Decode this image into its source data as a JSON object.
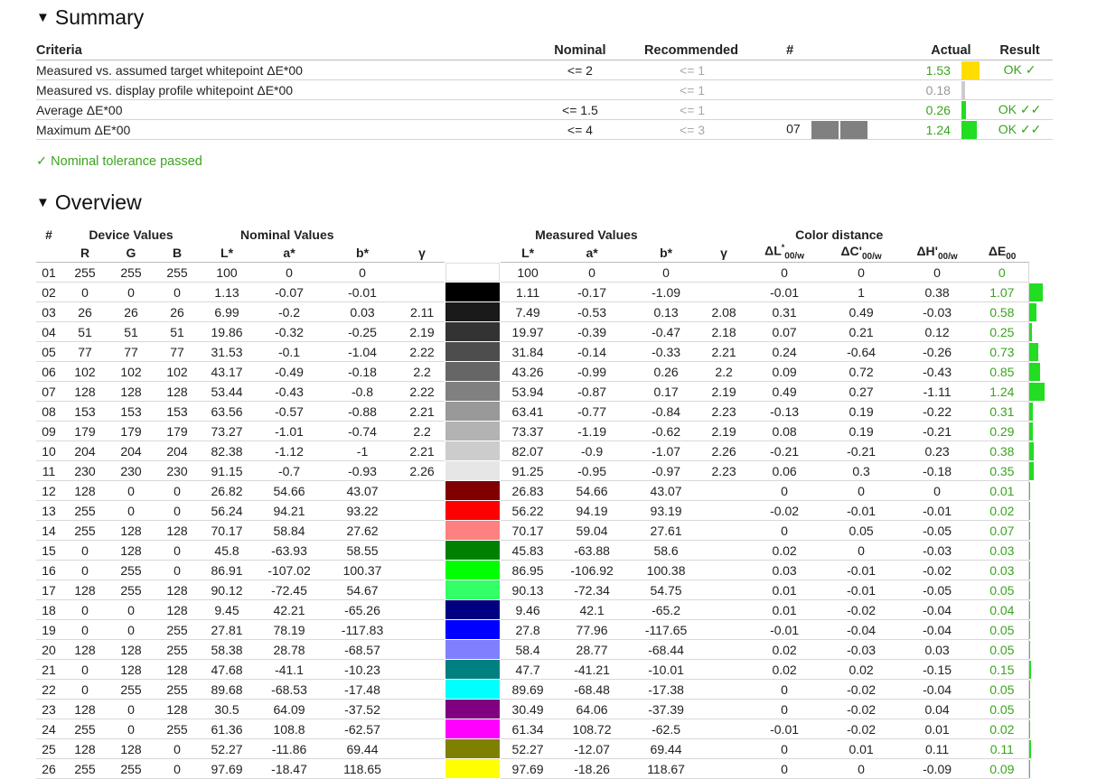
{
  "summary": {
    "title": "Summary",
    "headers": {
      "criteria": "Criteria",
      "nominal": "Nominal",
      "recommended": "Recommended",
      "hash": "#",
      "actual": "Actual",
      "result": "Result"
    },
    "rows": [
      {
        "criteria": "Measured vs. assumed target whitepoint ΔE*00",
        "nominal": "<= 2",
        "recommended": "<= 1",
        "hash": "",
        "actual": "1.53",
        "result": "OK ✓",
        "color": "#ffdd00",
        "swatch_width": 20
      },
      {
        "criteria": "Measured vs. display profile whitepoint ΔE*00",
        "nominal": "",
        "recommended": "<= 1",
        "hash": "",
        "actual": "0.18",
        "result": "",
        "color": "#cccccc",
        "swatch_width": 4
      },
      {
        "criteria": "Average ΔE*00",
        "nominal": "<= 1.5",
        "recommended": "<= 1",
        "hash": "",
        "actual": "0.26",
        "result": "OK ✓✓",
        "color": "#22dd22",
        "swatch_width": 5
      },
      {
        "criteria": "Maximum ΔE*00",
        "nominal": "<= 4",
        "recommended": "<= 3",
        "hash": "07",
        "actual": "1.24",
        "result": "OK ✓✓",
        "color": "#22dd22",
        "swatch_width": 17
      }
    ],
    "tolerance_text": "✓ Nominal tolerance passed",
    "patch_color": "#808080"
  },
  "overview": {
    "title": "Overview",
    "group_headers": {
      "hash": "#",
      "device": "Device Values",
      "nominal": "Nominal Values",
      "measured": "Measured Values",
      "distance": "Color distance"
    },
    "col_headers": {
      "r": "R",
      "g": "G",
      "b": "B",
      "l": "L*",
      "a": "a*",
      "bb": "b*",
      "gamma": "γ"
    },
    "rows": [
      {
        "n": "01",
        "r": "255",
        "g": "255",
        "b": "255",
        "nl": "100",
        "na": "0",
        "nb": "0",
        "ng": "",
        "color": "#ffffff",
        "ml": "100",
        "ma": "0",
        "mb": "0",
        "mg": "",
        "dl": "0",
        "dc": "0",
        "dh": "0",
        "de": "0"
      },
      {
        "n": "02",
        "r": "0",
        "g": "0",
        "b": "0",
        "nl": "1.13",
        "na": "-0.07",
        "nb": "-0.01",
        "ng": "",
        "color": "#000000",
        "ml": "1.11",
        "ma": "-0.17",
        "mb": "-1.09",
        "mg": "",
        "dl": "-0.01",
        "dc": "1",
        "dh": "0.38",
        "de": "1.07"
      },
      {
        "n": "03",
        "r": "26",
        "g": "26",
        "b": "26",
        "nl": "6.99",
        "na": "-0.2",
        "nb": "0.03",
        "ng": "2.11",
        "color": "#1a1a1a",
        "ml": "7.49",
        "ma": "-0.53",
        "mb": "0.13",
        "mg": "2.08",
        "dl": "0.31",
        "dc": "0.49",
        "dh": "-0.03",
        "de": "0.58"
      },
      {
        "n": "04",
        "r": "51",
        "g": "51",
        "b": "51",
        "nl": "19.86",
        "na": "-0.32",
        "nb": "-0.25",
        "ng": "2.19",
        "color": "#333333",
        "ml": "19.97",
        "ma": "-0.39",
        "mb": "-0.47",
        "mg": "2.18",
        "dl": "0.07",
        "dc": "0.21",
        "dh": "0.12",
        "de": "0.25"
      },
      {
        "n": "05",
        "r": "77",
        "g": "77",
        "b": "77",
        "nl": "31.53",
        "na": "-0.1",
        "nb": "-1.04",
        "ng": "2.22",
        "color": "#4d4d4d",
        "ml": "31.84",
        "ma": "-0.14",
        "mb": "-0.33",
        "mg": "2.21",
        "dl": "0.24",
        "dc": "-0.64",
        "dh": "-0.26",
        "de": "0.73"
      },
      {
        "n": "06",
        "r": "102",
        "g": "102",
        "b": "102",
        "nl": "43.17",
        "na": "-0.49",
        "nb": "-0.18",
        "ng": "2.2",
        "color": "#666666",
        "ml": "43.26",
        "ma": "-0.99",
        "mb": "0.26",
        "mg": "2.2",
        "dl": "0.09",
        "dc": "0.72",
        "dh": "-0.43",
        "de": "0.85"
      },
      {
        "n": "07",
        "r": "128",
        "g": "128",
        "b": "128",
        "nl": "53.44",
        "na": "-0.43",
        "nb": "-0.8",
        "ng": "2.22",
        "color": "#808080",
        "ml": "53.94",
        "ma": "-0.87",
        "mb": "0.17",
        "mg": "2.19",
        "dl": "0.49",
        "dc": "0.27",
        "dh": "-1.11",
        "de": "1.24"
      },
      {
        "n": "08",
        "r": "153",
        "g": "153",
        "b": "153",
        "nl": "63.56",
        "na": "-0.57",
        "nb": "-0.88",
        "ng": "2.21",
        "color": "#999999",
        "ml": "63.41",
        "ma": "-0.77",
        "mb": "-0.84",
        "mg": "2.23",
        "dl": "-0.13",
        "dc": "0.19",
        "dh": "-0.22",
        "de": "0.31"
      },
      {
        "n": "09",
        "r": "179",
        "g": "179",
        "b": "179",
        "nl": "73.27",
        "na": "-1.01",
        "nb": "-0.74",
        "ng": "2.2",
        "color": "#b3b3b3",
        "ml": "73.37",
        "ma": "-1.19",
        "mb": "-0.62",
        "mg": "2.19",
        "dl": "0.08",
        "dc": "0.19",
        "dh": "-0.21",
        "de": "0.29"
      },
      {
        "n": "10",
        "r": "204",
        "g": "204",
        "b": "204",
        "nl": "82.38",
        "na": "-1.12",
        "nb": "-1",
        "ng": "2.21",
        "color": "#cccccc",
        "ml": "82.07",
        "ma": "-0.9",
        "mb": "-1.07",
        "mg": "2.26",
        "dl": "-0.21",
        "dc": "-0.21",
        "dh": "0.23",
        "de": "0.38"
      },
      {
        "n": "11",
        "r": "230",
        "g": "230",
        "b": "230",
        "nl": "91.15",
        "na": "-0.7",
        "nb": "-0.93",
        "ng": "2.26",
        "color": "#e6e6e6",
        "ml": "91.25",
        "ma": "-0.95",
        "mb": "-0.97",
        "mg": "2.23",
        "dl": "0.06",
        "dc": "0.3",
        "dh": "-0.18",
        "de": "0.35"
      },
      {
        "n": "12",
        "r": "128",
        "g": "0",
        "b": "0",
        "nl": "26.82",
        "na": "54.66",
        "nb": "43.07",
        "ng": "",
        "color": "#800000",
        "ml": "26.83",
        "ma": "54.66",
        "mb": "43.07",
        "mg": "",
        "dl": "0",
        "dc": "0",
        "dh": "0",
        "de": "0.01"
      },
      {
        "n": "13",
        "r": "255",
        "g": "0",
        "b": "0",
        "nl": "56.24",
        "na": "94.21",
        "nb": "93.22",
        "ng": "",
        "color": "#ff0000",
        "ml": "56.22",
        "ma": "94.19",
        "mb": "93.19",
        "mg": "",
        "dl": "-0.02",
        "dc": "-0.01",
        "dh": "-0.01",
        "de": "0.02"
      },
      {
        "n": "14",
        "r": "255",
        "g": "128",
        "b": "128",
        "nl": "70.17",
        "na": "58.84",
        "nb": "27.62",
        "ng": "",
        "color": "#ff8080",
        "ml": "70.17",
        "ma": "59.04",
        "mb": "27.61",
        "mg": "",
        "dl": "0",
        "dc": "0.05",
        "dh": "-0.05",
        "de": "0.07"
      },
      {
        "n": "15",
        "r": "0",
        "g": "128",
        "b": "0",
        "nl": "45.8",
        "na": "-63.93",
        "nb": "58.55",
        "ng": "",
        "color": "#008000",
        "ml": "45.83",
        "ma": "-63.88",
        "mb": "58.6",
        "mg": "",
        "dl": "0.02",
        "dc": "0",
        "dh": "-0.03",
        "de": "0.03"
      },
      {
        "n": "16",
        "r": "0",
        "g": "255",
        "b": "0",
        "nl": "86.91",
        "na": "-107.02",
        "nb": "100.37",
        "ng": "",
        "color": "#00ff00",
        "ml": "86.95",
        "ma": "-106.92",
        "mb": "100.38",
        "mg": "",
        "dl": "0.03",
        "dc": "-0.01",
        "dh": "-0.02",
        "de": "0.03"
      },
      {
        "n": "17",
        "r": "128",
        "g": "255",
        "b": "128",
        "nl": "90.12",
        "na": "-72.45",
        "nb": "54.67",
        "ng": "",
        "color": "#33ff66",
        "ml": "90.13",
        "ma": "-72.34",
        "mb": "54.75",
        "mg": "",
        "dl": "0.01",
        "dc": "-0.01",
        "dh": "-0.05",
        "de": "0.05"
      },
      {
        "n": "18",
        "r": "0",
        "g": "0",
        "b": "128",
        "nl": "9.45",
        "na": "42.21",
        "nb": "-65.26",
        "ng": "",
        "color": "#000080",
        "ml": "9.46",
        "ma": "42.1",
        "mb": "-65.2",
        "mg": "",
        "dl": "0.01",
        "dc": "-0.02",
        "dh": "-0.04",
        "de": "0.04"
      },
      {
        "n": "19",
        "r": "0",
        "g": "0",
        "b": "255",
        "nl": "27.81",
        "na": "78.19",
        "nb": "-117.83",
        "ng": "",
        "color": "#0000ff",
        "ml": "27.8",
        "ma": "77.96",
        "mb": "-117.65",
        "mg": "",
        "dl": "-0.01",
        "dc": "-0.04",
        "dh": "-0.04",
        "de": "0.05"
      },
      {
        "n": "20",
        "r": "128",
        "g": "128",
        "b": "255",
        "nl": "58.38",
        "na": "28.78",
        "nb": "-68.57",
        "ng": "",
        "color": "#8080ff",
        "ml": "58.4",
        "ma": "28.77",
        "mb": "-68.44",
        "mg": "",
        "dl": "0.02",
        "dc": "-0.03",
        "dh": "0.03",
        "de": "0.05"
      },
      {
        "n": "21",
        "r": "0",
        "g": "128",
        "b": "128",
        "nl": "47.68",
        "na": "-41.1",
        "nb": "-10.23",
        "ng": "",
        "color": "#008080",
        "ml": "47.7",
        "ma": "-41.21",
        "mb": "-10.01",
        "mg": "",
        "dl": "0.02",
        "dc": "0.02",
        "dh": "-0.15",
        "de": "0.15"
      },
      {
        "n": "22",
        "r": "0",
        "g": "255",
        "b": "255",
        "nl": "89.68",
        "na": "-68.53",
        "nb": "-17.48",
        "ng": "",
        "color": "#00ffff",
        "ml": "89.69",
        "ma": "-68.48",
        "mb": "-17.38",
        "mg": "",
        "dl": "0",
        "dc": "-0.02",
        "dh": "-0.04",
        "de": "0.05"
      },
      {
        "n": "23",
        "r": "128",
        "g": "0",
        "b": "128",
        "nl": "30.5",
        "na": "64.09",
        "nb": "-37.52",
        "ng": "",
        "color": "#800080",
        "ml": "30.49",
        "ma": "64.06",
        "mb": "-37.39",
        "mg": "",
        "dl": "0",
        "dc": "-0.02",
        "dh": "0.04",
        "de": "0.05"
      },
      {
        "n": "24",
        "r": "255",
        "g": "0",
        "b": "255",
        "nl": "61.36",
        "na": "108.8",
        "nb": "-62.57",
        "ng": "",
        "color": "#ff00ff",
        "ml": "61.34",
        "ma": "108.72",
        "mb": "-62.5",
        "mg": "",
        "dl": "-0.01",
        "dc": "-0.02",
        "dh": "0.01",
        "de": "0.02"
      },
      {
        "n": "25",
        "r": "128",
        "g": "128",
        "b": "0",
        "nl": "52.27",
        "na": "-11.86",
        "nb": "69.44",
        "ng": "",
        "color": "#808000",
        "ml": "52.27",
        "ma": "-12.07",
        "mb": "69.44",
        "mg": "",
        "dl": "0",
        "dc": "0.01",
        "dh": "0.11",
        "de": "0.11"
      },
      {
        "n": "26",
        "r": "255",
        "g": "255",
        "b": "0",
        "nl": "97.69",
        "na": "-18.47",
        "nb": "118.65",
        "ng": "",
        "color": "#ffff00",
        "ml": "97.69",
        "ma": "-18.26",
        "mb": "118.67",
        "mg": "",
        "dl": "0",
        "dc": "0",
        "dh": "-0.09",
        "de": "0.09"
      }
    ]
  }
}
